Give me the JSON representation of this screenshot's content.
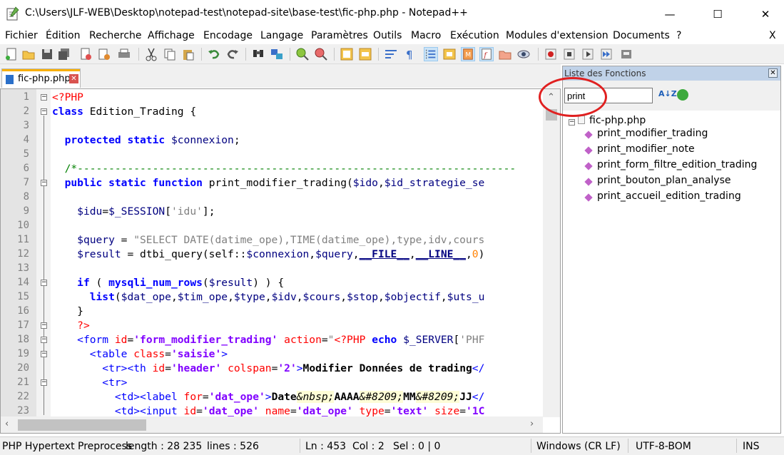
{
  "window": {
    "title": "C:\\Users\\JLF-WEB\\Desktop\\notepad-test\\notepad-site\\base-test\\fic-php.php - Notepad++",
    "min_label": "—",
    "max_label": "☐",
    "close_label": "✕"
  },
  "menu": {
    "items": [
      "Fichier",
      "Édition",
      "Recherche",
      "Affichage",
      "Encodage",
      "Langage",
      "Paramètres",
      "Outils",
      "Macro",
      "Exécution",
      "Modules d'extension",
      "Documents",
      "?"
    ],
    "close_doc": "X"
  },
  "tabs": [
    {
      "label": "fic-php.php",
      "close": "✕"
    }
  ],
  "editor": {
    "line_numbers": [
      "1",
      "2",
      "3",
      "4",
      "5",
      "6",
      "7",
      "8",
      "9",
      "10",
      "11",
      "12",
      "13",
      "14",
      "15",
      "16",
      "17",
      "18",
      "19",
      "20",
      "21",
      "22",
      "23"
    ]
  },
  "function_list": {
    "title": "Liste des Fonctions",
    "close": "✕",
    "search_value": "print",
    "sort_icon": "A↓Z",
    "file": "fic-php.php",
    "functions": [
      "print_modifier_trading",
      "print_modifier_note",
      "print_form_filtre_edition_trading",
      "print_bouton_plan_analyse",
      "print_accueil_edition_trading"
    ]
  },
  "status": {
    "language": "PHP Hypertext Preprocess",
    "length": "length : 28 235",
    "lines": "lines : 526",
    "ln": "Ln : 453",
    "col": "Col : 2",
    "sel": "Sel : 0 | 0",
    "eol": "Windows (CR LF)",
    "encoding": "UTF-8-BOM",
    "mode": "INS"
  },
  "colors": {
    "keyword": "#0000ff",
    "string": "#808080",
    "comment": "#008000",
    "php_tag": "#ff0000",
    "tab_accent": "#f9b000",
    "annotation": "#e02020"
  }
}
